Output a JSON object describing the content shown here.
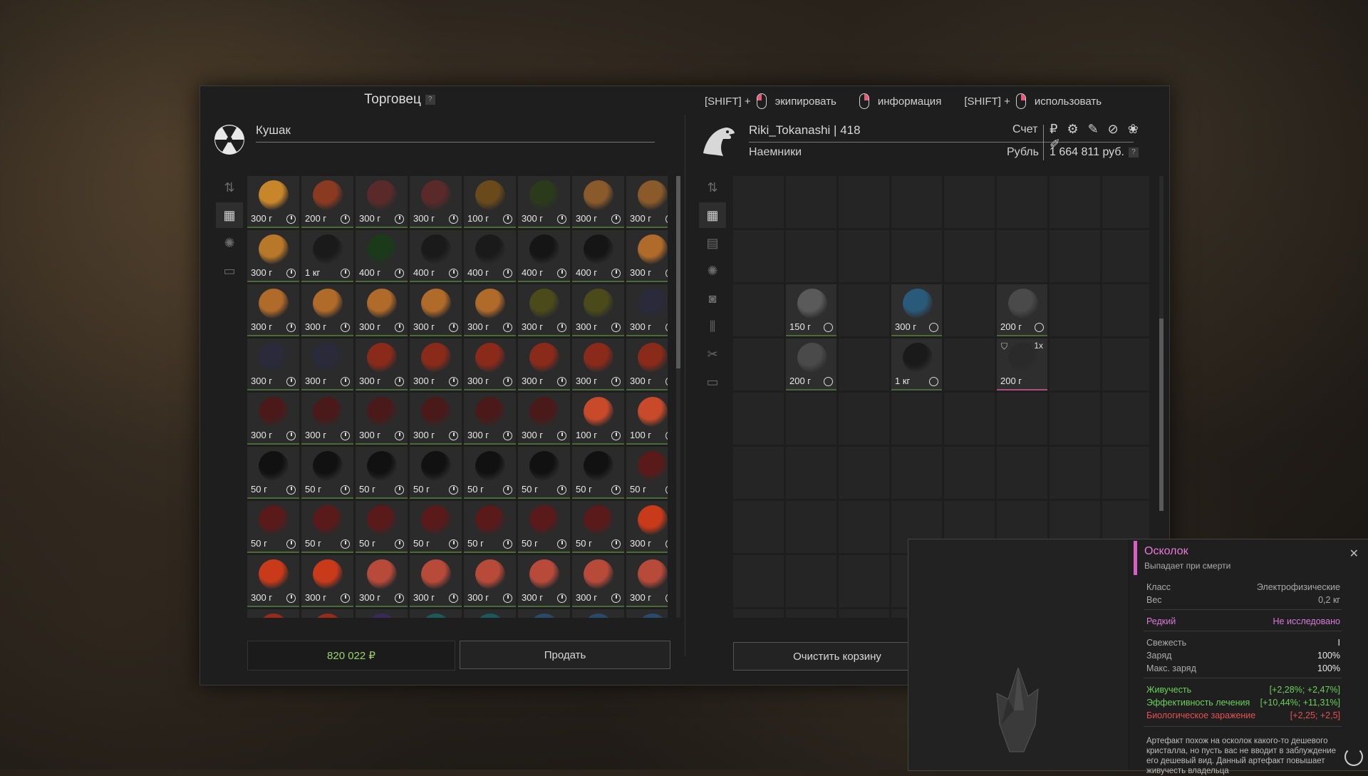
{
  "window": {
    "title": "Торговец",
    "help": "?"
  },
  "hints": [
    {
      "key": "[SHIFT] +",
      "button": "left",
      "label": "экипировать"
    },
    {
      "key": "",
      "button": "right",
      "label": "информация"
    },
    {
      "key": "[SHIFT] +",
      "button": "right",
      "label": "использовать"
    }
  ],
  "trader": {
    "name": "Кушак",
    "money": "820 022 ₽",
    "sell_label": "Продать",
    "tabs": [
      "sort-icon",
      "grid-icon",
      "artifact-icon",
      "box-icon"
    ]
  },
  "player": {
    "name": "Riki_Tokanashi | 418",
    "faction": "Наемники",
    "account_label": "Счет",
    "currency_label": "Рубль",
    "balance": "1 664 811 руб.",
    "currency_icons": "₽ ⚙ ✎ ⊘ ❀ ✐",
    "clear_label": "Очистить корзину",
    "tabs": [
      "sort-icon",
      "grid-icon",
      "armor-icon",
      "artifact-icon",
      "camera-icon",
      "ammo-icon",
      "tools-icon",
      "box-icon"
    ]
  },
  "trader_items": [
    {
      "w": "300 г",
      "c": "#c8862a"
    },
    {
      "w": "200 г",
      "c": "#8a3a20"
    },
    {
      "w": "300 г",
      "c": "#5a2a2a"
    },
    {
      "w": "300 г",
      "c": "#5a2a2a"
    },
    {
      "w": "100 г",
      "c": "#6a4a1a"
    },
    {
      "w": "300 г",
      "c": "#2a3a1a"
    },
    {
      "w": "300 г",
      "c": "#8a5a2a"
    },
    {
      "w": "300 г",
      "c": "#8a5a2a"
    },
    {
      "w": "300 г",
      "c": "#b8782a"
    },
    {
      "w": "1 кг",
      "c": "#1a1a1a"
    },
    {
      "w": "400 г",
      "c": "#1a3a1a"
    },
    {
      "w": "400 г",
      "c": "#1a1a1a"
    },
    {
      "w": "400 г",
      "c": "#1a1a1a"
    },
    {
      "w": "400 г",
      "c": "#151515"
    },
    {
      "w": "400 г",
      "c": "#151515"
    },
    {
      "w": "300 г",
      "c": "#b06a2a"
    },
    {
      "w": "300 г",
      "c": "#b06a2a"
    },
    {
      "w": "300 г",
      "c": "#b06a2a"
    },
    {
      "w": "300 г",
      "c": "#b06a2a"
    },
    {
      "w": "300 г",
      "c": "#b06a2a"
    },
    {
      "w": "300 г",
      "c": "#b06a2a"
    },
    {
      "w": "300 г",
      "c": "#4a4a1a"
    },
    {
      "w": "300 г",
      "c": "#4a4a1a"
    },
    {
      "w": "300 г",
      "c": "#2a2a3a"
    },
    {
      "w": "300 г",
      "c": "#2a2a3a"
    },
    {
      "w": "300 г",
      "c": "#2a2a3a"
    },
    {
      "w": "300 г",
      "c": "#8a2a1a"
    },
    {
      "w": "300 г",
      "c": "#8a2a1a"
    },
    {
      "w": "300 г",
      "c": "#8a2a1a"
    },
    {
      "w": "300 г",
      "c": "#8a2a1a"
    },
    {
      "w": "300 г",
      "c": "#8a2a1a"
    },
    {
      "w": "300 г",
      "c": "#8a2a1a"
    },
    {
      "w": "300 г",
      "c": "#4a1a1a"
    },
    {
      "w": "300 г",
      "c": "#4a1a1a"
    },
    {
      "w": "300 г",
      "c": "#4a1a1a"
    },
    {
      "w": "300 г",
      "c": "#4a1a1a"
    },
    {
      "w": "300 г",
      "c": "#4a1a1a"
    },
    {
      "w": "300 г",
      "c": "#4a1a1a"
    },
    {
      "w": "100 г",
      "c": "#c84a2a"
    },
    {
      "w": "100 г",
      "c": "#c84a2a"
    },
    {
      "w": "50 г",
      "c": "#111111"
    },
    {
      "w": "50 г",
      "c": "#111111"
    },
    {
      "w": "50 г",
      "c": "#111111"
    },
    {
      "w": "50 г",
      "c": "#111111"
    },
    {
      "w": "50 г",
      "c": "#111111"
    },
    {
      "w": "50 г",
      "c": "#111111"
    },
    {
      "w": "50 г",
      "c": "#111111"
    },
    {
      "w": "50 г",
      "c": "#5a1a1a"
    },
    {
      "w": "50 г",
      "c": "#5a1a1a"
    },
    {
      "w": "50 г",
      "c": "#5a1a1a"
    },
    {
      "w": "50 г",
      "c": "#5a1a1a"
    },
    {
      "w": "50 г",
      "c": "#5a1a1a"
    },
    {
      "w": "50 г",
      "c": "#5a1a1a"
    },
    {
      "w": "50 г",
      "c": "#5a1a1a"
    },
    {
      "w": "50 г",
      "c": "#5a1a1a"
    },
    {
      "w": "300 г",
      "c": "#c83a1a"
    },
    {
      "w": "300 г",
      "c": "#c83a1a"
    },
    {
      "w": "300 г",
      "c": "#c83a1a"
    },
    {
      "w": "300 г",
      "c": "#b84a3a"
    },
    {
      "w": "300 г",
      "c": "#b84a3a"
    },
    {
      "w": "300 г",
      "c": "#b84a3a"
    },
    {
      "w": "300 г",
      "c": "#b84a3a"
    },
    {
      "w": "300 г",
      "c": "#b84a3a"
    },
    {
      "w": "300 г",
      "c": "#b84a3a"
    },
    {
      "w": "",
      "c": "#9a2a1a"
    },
    {
      "w": "",
      "c": "#9a2a1a"
    },
    {
      "w": "",
      "c": "#3a2a5a"
    },
    {
      "w": "",
      "c": "#1a5a5a"
    },
    {
      "w": "",
      "c": "#1a5a5a"
    },
    {
      "w": "",
      "c": "#2a4a6a"
    },
    {
      "w": "",
      "c": "#2a4a6a"
    },
    {
      "w": "",
      "c": "#2a4a6a"
    }
  ],
  "player_items": [
    {
      "slot": 17,
      "w": "150 г",
      "c": "#5a5a5a",
      "qty": "",
      "shield": false
    },
    {
      "slot": 19,
      "w": "300 г",
      "c": "#2a5a7a",
      "qty": "",
      "shield": false
    },
    {
      "slot": 21,
      "w": "200 г",
      "c": "#4a4a4a",
      "qty": "",
      "shield": false
    },
    {
      "slot": 25,
      "w": "200 г",
      "c": "#4a4a4a",
      "qty": "",
      "shield": false
    },
    {
      "slot": 27,
      "w": "1 кг",
      "c": "#1a1a1a",
      "qty": "",
      "shield": false
    },
    {
      "slot": 29,
      "w": "200 г",
      "c": "#2a2a2a",
      "qty": "1x",
      "shield": true
    }
  ],
  "tooltip": {
    "name": "Осколок",
    "subtitle": "Выпадает при смерти",
    "class_label": "Класс",
    "class_value": "Электрофизические",
    "weight_label": "Вес",
    "weight_value": "0,2 кг",
    "rarity": "Редкий",
    "research": "Не исследовано",
    "freshness_label": "Свежесть",
    "freshness_value": "I",
    "charge_label": "Заряд",
    "charge_value": "100%",
    "maxcharge_label": "Макс. заряд",
    "maxcharge_value": "100%",
    "stat1_label": "Живучесть",
    "stat1_value": "[+2,28%; +2,47%]",
    "stat2_label": "Эффективность лечения",
    "stat2_value": "[+10,44%; +11,31%]",
    "stat3_label": "Биологическое заражение",
    "stat3_value": "[+2,25; +2,5]",
    "description": "Артефакт похож на осколок какого-то дешевого кристалла, но пусть вас не вводит в заблуждение его дешевый вид. Данный артефакт повышает живучесть владельца"
  }
}
